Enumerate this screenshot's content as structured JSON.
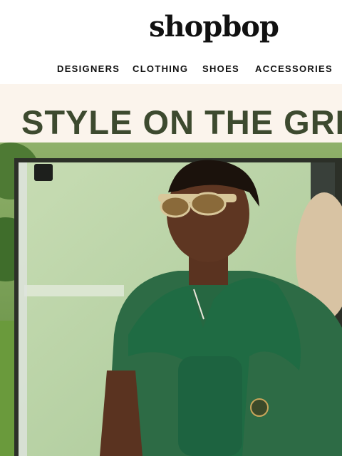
{
  "header": {
    "logo": "shopbop",
    "nav": [
      "DESIGNERS",
      "CLOTHING",
      "SHOES",
      "ACCESSORIES"
    ]
  },
  "hero": {
    "title": "STYLE ON THE GREEN"
  },
  "colors": {
    "title": "#3d4a2f",
    "hero_bg": "#fbf4ec",
    "sweater": "#1f6b43",
    "polo": "#2d6b45"
  }
}
